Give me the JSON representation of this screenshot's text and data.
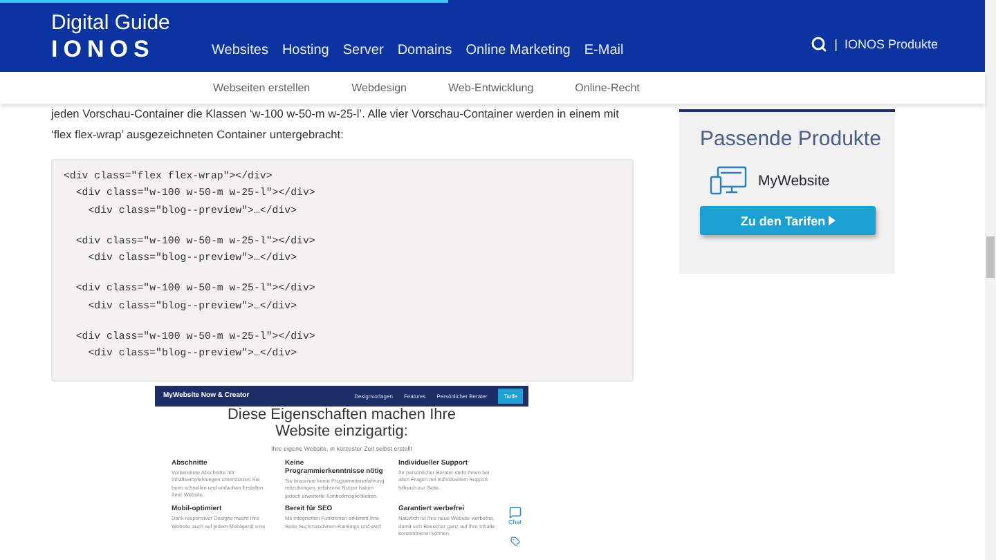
{
  "reading_progress": {
    "level": 0.45
  },
  "header": {
    "brand_title": "Digital Guide",
    "brand_logo": "IONOS",
    "nav": [
      "Websites",
      "Hosting",
      "Server",
      "Domains",
      "Online Marketing",
      "E-Mail"
    ],
    "separator": "|",
    "products_link": "IONOS Produkte"
  },
  "subnav": [
    "Webseiten erstellen",
    "Webdesign",
    "Web-Entwicklung",
    "Online-Recht"
  ],
  "article": {
    "paragraph": [
      "jeden Vorschau-Container die Klassen ‘w-100 w-50-m w-25-l’. Alle vier Vorschau-Container werden in einem mit",
      "‘flex flex-wrap’ ausgezeichneten Container untergebracht:"
    ],
    "code_groups": [
      [
        "<div class=\"flex flex-wrap\"></div>",
        "  <div class=\"w-100 w-50-m w-25-l\"></div>",
        "    <div class=\"blog--preview\">…</div>"
      ],
      [
        "  <div class=\"w-100 w-50-m w-25-l\"></div>",
        "    <div class=\"blog--preview\">…</div>"
      ],
      [
        "  <div class=\"w-100 w-50-m w-25-l\"></div>",
        "    <div class=\"blog--preview\">…</div>"
      ],
      [
        "  <div class=\"w-100 w-50-m w-25-l\"></div>",
        "    <div class=\"blog--preview\">…</div>"
      ]
    ],
    "screenshot": {
      "brand": "MyWebsite Now & Creator",
      "nav": [
        {
          "label": "Designvorlagen",
          "selected": false
        },
        {
          "label": "Features",
          "selected": false
        },
        {
          "label": "Persönlicher Berater",
          "selected": false
        },
        {
          "label": "Tarife",
          "selected": true
        }
      ],
      "heading": "Diese Eigenschaften machen Ihre Website einzigartig:",
      "subtitle": "Ihre eigene Website, in kürzester Zeit selbst erstellt",
      "features": [
        {
          "title": "Abschnitte",
          "text": "Vorbereitete Abschnitte mit Inhaltsempfehlungen unterstützen Sie beim schnellen und einfachen Erstellen Ihrer Website."
        },
        {
          "title": "Keine Programmierkenntnisse nötig",
          "text": "Sie brauchen keine Programmiererfahrung mitzubringen, erfahrene Nutzer haben jedoch erweiterte Kontrollmöglichkeiten."
        },
        {
          "title": "Individueller Support",
          "text": "Ihr persönlicher Berater steht Ihnen bei allen Fragen mit individuellem Support hilfreich zur Seite."
        },
        {
          "title": "Mobil-optimiert",
          "text": "Dank responsiver Designs macht Ihre Website auch auf jedem Mobilgerät eine"
        },
        {
          "title": "Bereit für SEO",
          "text": "Mit integrierten Funktionen erklimmt Ihre Seite Suchmaschinen-Rankings und wird"
        },
        {
          "title": "Garantiert werbefrei",
          "text": "Natürlich ist Ihre neue Website werbefrei, damit sich Besucher ganz auf Ihre Inhalte konzentrieren können."
        }
      ],
      "chat_label": "Chat"
    }
  },
  "sidebar": {
    "title": "Passende Produkte",
    "product": "MyWebsite",
    "button": "Zu den Tarifen"
  }
}
